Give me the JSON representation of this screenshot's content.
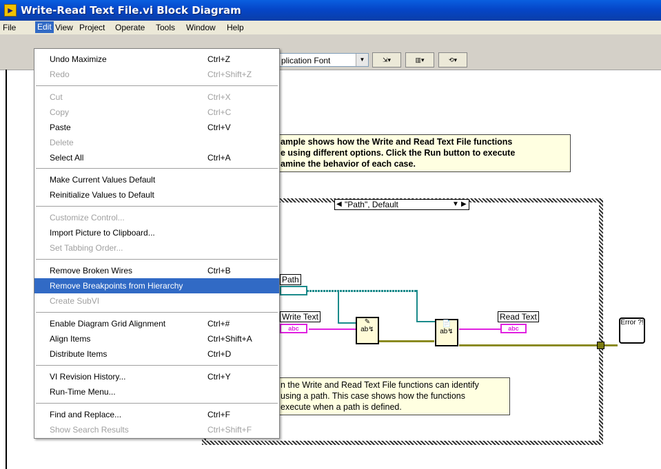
{
  "window": {
    "title": "Write-Read Text File.vi Block Diagram"
  },
  "menubar": [
    "File",
    "Edit",
    "View",
    "Project",
    "Operate",
    "Tools",
    "Window",
    "Help"
  ],
  "toolbar": {
    "font": "plication Font"
  },
  "edit_menu": {
    "items": [
      {
        "label": "Undo Maximize",
        "shortcut": "Ctrl+Z",
        "disabled": false
      },
      {
        "label": "Redo",
        "shortcut": "Ctrl+Shift+Z",
        "disabled": true
      },
      {
        "label": "Cut",
        "shortcut": "Ctrl+X",
        "disabled": true
      },
      {
        "label": "Copy",
        "shortcut": "Ctrl+C",
        "disabled": true
      },
      {
        "label": "Paste",
        "shortcut": "Ctrl+V",
        "disabled": false
      },
      {
        "label": "Delete",
        "shortcut": "",
        "disabled": true
      },
      {
        "label": "Select All",
        "shortcut": "Ctrl+A",
        "disabled": false
      },
      {
        "label": "Make Current Values Default",
        "shortcut": "",
        "disabled": false
      },
      {
        "label": "Reinitialize Values to Default",
        "shortcut": "",
        "disabled": false
      },
      {
        "label": "Customize Control...",
        "shortcut": "",
        "disabled": true
      },
      {
        "label": "Import Picture to Clipboard...",
        "shortcut": "",
        "disabled": false
      },
      {
        "label": "Set Tabbing Order...",
        "shortcut": "",
        "disabled": true
      },
      {
        "label": "Remove Broken Wires",
        "shortcut": "Ctrl+B",
        "disabled": false
      },
      {
        "label": "Remove Breakpoints from Hierarchy",
        "shortcut": "",
        "disabled": false,
        "highlighted": true
      },
      {
        "label": "Create SubVI",
        "shortcut": "",
        "disabled": true
      },
      {
        "label": "Enable Diagram Grid Alignment",
        "shortcut": "Ctrl+#",
        "disabled": false
      },
      {
        "label": "Align Items",
        "shortcut": "Ctrl+Shift+A",
        "disabled": false
      },
      {
        "label": "Distribute Items",
        "shortcut": "Ctrl+D",
        "disabled": false
      },
      {
        "label": "VI Revision History...",
        "shortcut": "Ctrl+Y",
        "disabled": false
      },
      {
        "label": "Run-Time Menu...",
        "shortcut": "",
        "disabled": false
      },
      {
        "label": "Find and Replace...",
        "shortcut": "Ctrl+F",
        "disabled": false
      },
      {
        "label": "Show Search Results",
        "shortcut": "Ctrl+Shift+F",
        "disabled": true
      }
    ]
  },
  "diagram": {
    "comment_top": [
      "ample shows how the Write and Read Text File functions",
      "e using different options.  Click the Run button to execute",
      "amine the behavior of each case."
    ],
    "case_selector": "\"Path\", Default",
    "labels": {
      "path": "Path",
      "write_text": "Write Text",
      "read_text": "Read Text"
    },
    "terminal_abc": "abc",
    "error_glyph": "Error ?!",
    "comment_bottom": [
      "n the Write and Read Text File functions can identify",
      " using a path.  This case shows how the functions",
      "execute when a path is defined."
    ]
  }
}
